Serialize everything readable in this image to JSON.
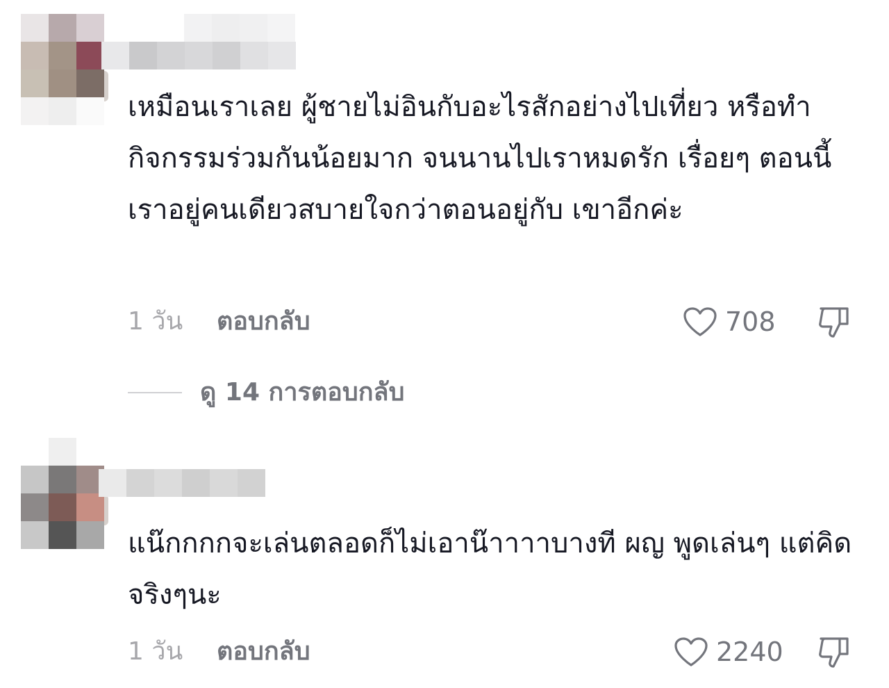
{
  "comments": [
    {
      "text": "เหมือนเราเลย ผู้ชายไม่อินกับอะไรสักอย่างไปเที่ยว หรือทำกิจกรรมร่วมกันน้อยมาก จนนานไปเราหมดรัก เรื่อยๆ ตอนนี้เราอยู่คนเดียวสบายใจกว่าตอนอยู่กับ เขาอีกค่ะ",
      "time": "1 วัน",
      "reply_label": "ตอบกลับ",
      "likes": "708",
      "view_replies_label": "ดู 14 การตอบกลับ",
      "avatar_colors": [
        "#e9e5e6",
        "#b7a9ab",
        "#d9cfd3",
        "#c8bcb3",
        "#a39487",
        "#8c4a58",
        "#c8c0b4",
        "#a09083",
        "#7c6d66",
        "#f3f2f2",
        "#eeeeee",
        "#fafafa"
      ],
      "username_colors": [
        "#e8e8ea",
        "#c9c9cb",
        "#d3d3d5",
        "#d8d8da",
        "#d0d0d2",
        "#e0e0e2",
        "#e6e6e8"
      ],
      "topline_colors": [
        "#f2f2f3",
        "#eeeeef",
        "#f0f0f1",
        "#f4f4f5"
      ]
    },
    {
      "text": "แน๊กกกกจะเล่นตลอดก็ไม่เอาน๊าาาาบางที ผญ พูดเล่นๆ แต่คิดจริงๆนะ",
      "time": "1 วัน",
      "reply_label": "ตอบกลับ",
      "likes": "2240",
      "avatar_colors": [
        "#ffffff",
        "#efefef",
        "#ffffff",
        "#c6c6c6",
        "#7a7878",
        "#a08c89",
        "#8d8989",
        "#7d5b56",
        "#c78e83",
        "#c8c8c8",
        "#555555",
        "#a8a8a8"
      ],
      "username_colors": [
        "#eaeaea",
        "#d4d4d4",
        "#dcdcdc",
        "#cfcfcf",
        "#d9d9d9",
        "#d2d2d2"
      ]
    }
  ],
  "colors": {
    "text": "#161823",
    "muted": "#a7a7ab",
    "secondary": "#73757c",
    "divider": "#cfd0d3"
  },
  "icons": {
    "like": "heart-icon",
    "dislike": "thumbs-down-icon"
  }
}
